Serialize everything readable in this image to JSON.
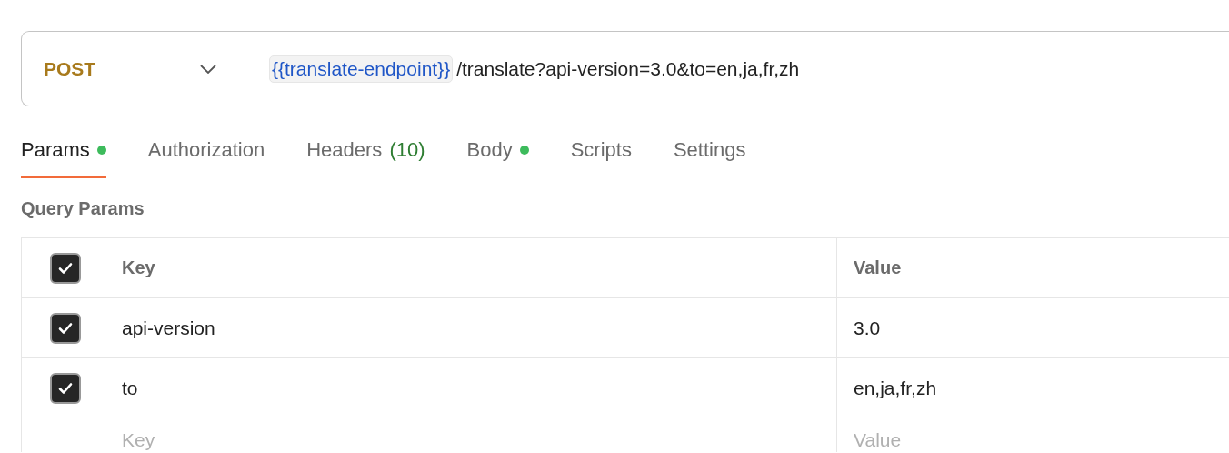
{
  "request": {
    "method": "POST",
    "url_variable": "{{translate-endpoint}}",
    "url_path": "/translate?api-version=3.0&to=en,ja,fr,zh"
  },
  "tabs": [
    {
      "label": "Params",
      "selected": true,
      "dot": true
    },
    {
      "label": "Authorization",
      "selected": false,
      "dot": false
    },
    {
      "label": "Headers",
      "count": "(10)",
      "selected": false,
      "dot": false
    },
    {
      "label": "Body",
      "selected": false,
      "dot": true
    },
    {
      "label": "Scripts",
      "selected": false,
      "dot": false
    },
    {
      "label": "Settings",
      "selected": false,
      "dot": false
    }
  ],
  "section_title": "Query Params",
  "table": {
    "columns": [
      "Key",
      "Value"
    ],
    "header_checked": true,
    "rows": [
      {
        "checked": true,
        "key": "api-version",
        "value": "3.0"
      },
      {
        "checked": true,
        "key": "to",
        "value": "en,ja,fr,zh"
      }
    ],
    "new_row": {
      "key_placeholder": "Key",
      "value_placeholder": "Value"
    }
  }
}
